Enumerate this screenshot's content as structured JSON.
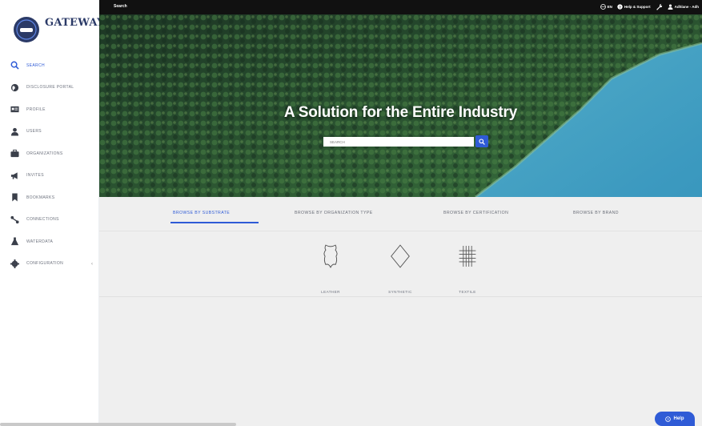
{
  "brand": {
    "name": "GATEWAY",
    "tagline": "",
    "colors": {
      "primary": "#2f5bd6",
      "navy": "#2b3a67",
      "topbar": "#111111",
      "content_bg": "#efefef"
    }
  },
  "sidebar": {
    "items": [
      {
        "label": "SEARCH",
        "icon": "search-icon",
        "active": true
      },
      {
        "label": "DISCLOSURE PORTAL",
        "icon": "globe-icon"
      },
      {
        "label": "PROFILE",
        "icon": "id-card-icon"
      },
      {
        "label": "USERS",
        "icon": "user-icon"
      },
      {
        "label": "ORGANIZATIONS",
        "icon": "briefcase-icon"
      },
      {
        "label": "INVITES",
        "icon": "bullhorn-icon"
      },
      {
        "label": "BOOKMARKS",
        "icon": "bookmark-icon"
      },
      {
        "label": "CONNECTIONS",
        "icon": "connections-icon"
      },
      {
        "label": "WATERDATA",
        "icon": "flask-icon"
      },
      {
        "label": "CONFIGURATION",
        "icon": "gear-icon",
        "expandable": true
      }
    ]
  },
  "topbar": {
    "menu_label": "Search",
    "items": [
      {
        "label": "EN",
        "icon": "globe-icon"
      },
      {
        "label": "Help & Support",
        "icon": "question-circle-icon"
      },
      {
        "label": "",
        "icon": "wrench-icon"
      },
      {
        "label": "Adhlane - Adh",
        "icon": "user-icon"
      }
    ]
  },
  "hero": {
    "title": "A Solution for the Entire Industry",
    "search_placeholder": "SEARCH"
  },
  "browse_tabs": [
    {
      "label": "BROWSE BY SUBSTRATE",
      "active": true
    },
    {
      "label": "BROWSE BY ORGANIZATION TYPE"
    },
    {
      "label": "BROWSE BY CERTIFICATION"
    },
    {
      "label": "BROWSE BY BRAND"
    }
  ],
  "substrates": [
    {
      "label": "LEATHER",
      "icon": "leather-hide-icon"
    },
    {
      "label": "SYNTHETIC",
      "icon": "diamond-icon"
    },
    {
      "label": "TEXTILE",
      "icon": "textile-weave-icon"
    }
  ],
  "help": {
    "label": "Help"
  }
}
